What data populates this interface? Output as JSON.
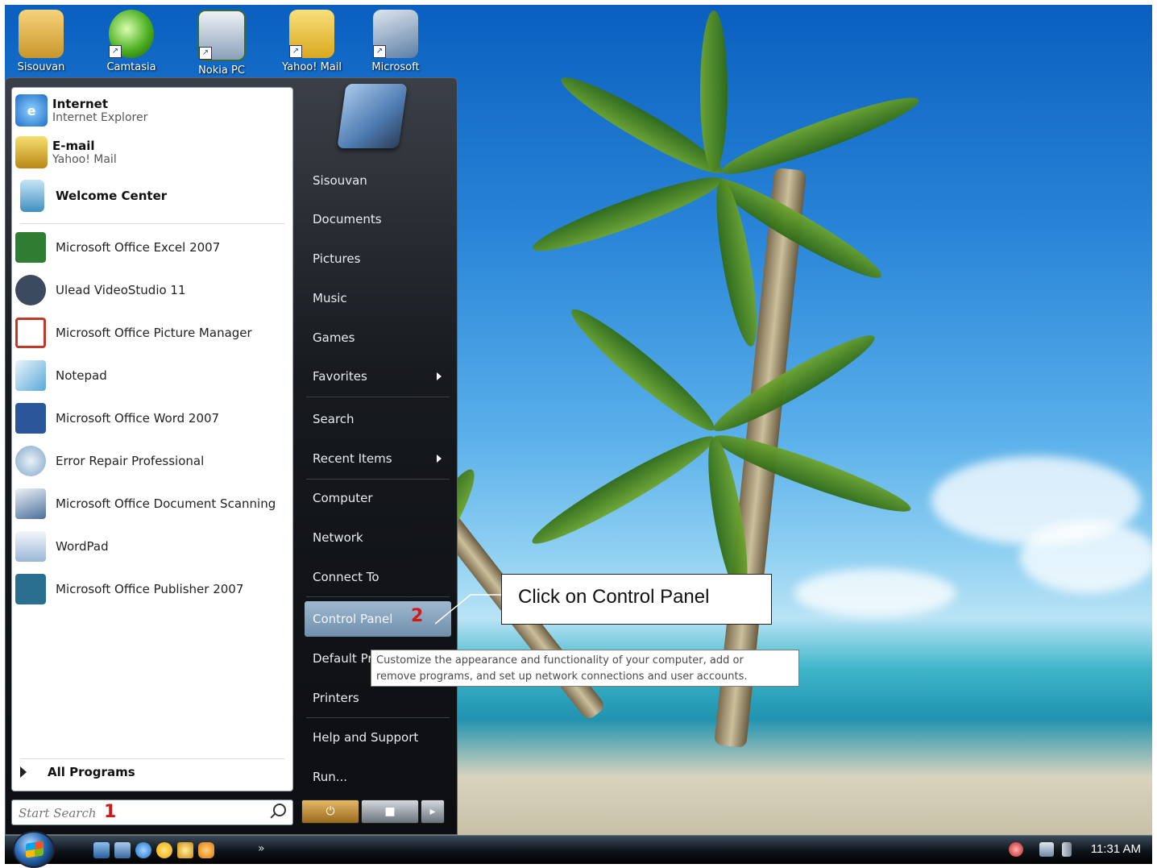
{
  "desktop": {
    "icons": [
      {
        "label": "Sisouvan",
        "icon": "folder-icon"
      },
      {
        "label": "Camtasia",
        "icon": "camtasia-icon"
      },
      {
        "label": "Nokia PC",
        "icon": "nokia-pc-suite-icon"
      },
      {
        "label": "Yahoo! Mail",
        "icon": "yahoo-mail-icon"
      },
      {
        "label": "Microsoft",
        "icon": "scanner-icon"
      }
    ]
  },
  "start_menu": {
    "pinned": [
      {
        "title": "Internet",
        "subtitle": "Internet Explorer",
        "icon": "internet-explorer-icon"
      },
      {
        "title": "E-mail",
        "subtitle": "Yahoo! Mail",
        "icon": "yahoo-mail-icon"
      }
    ],
    "welcome": {
      "title": "Welcome Center",
      "icon": "welcome-center-icon"
    },
    "programs": [
      {
        "label": "Microsoft Office Excel 2007",
        "icon": "excel-icon",
        "color": "#2f7d32"
      },
      {
        "label": "Ulead VideoStudio 11",
        "icon": "videostudio-icon",
        "color": "#3b4a5e"
      },
      {
        "label": "Microsoft Office Picture Manager",
        "icon": "picture-manager-icon",
        "color": "#c0392b"
      },
      {
        "label": "Notepad",
        "icon": "notepad-icon",
        "color": "#5aa9d8"
      },
      {
        "label": "Microsoft Office Word 2007",
        "icon": "word-icon",
        "color": "#2b579a"
      },
      {
        "label": "Error Repair Professional",
        "icon": "error-repair-icon",
        "color": "#7fa6c8"
      },
      {
        "label": "Microsoft Office Document Scanning",
        "icon": "document-scanning-icon",
        "color": "#4b6f9c"
      },
      {
        "label": "WordPad",
        "icon": "wordpad-icon",
        "color": "#9ab7d6"
      },
      {
        "label": "Microsoft Office Publisher 2007",
        "icon": "publisher-icon",
        "color": "#2a6f8f"
      }
    ],
    "all_programs": "All Programs",
    "search": {
      "placeholder": "Start Search",
      "step_marker": "1"
    },
    "right_items": [
      {
        "label": "Sisouvan",
        "submenu": false
      },
      {
        "label": "Documents",
        "submenu": false
      },
      {
        "label": "Pictures",
        "submenu": false
      },
      {
        "label": "Music",
        "submenu": false
      },
      {
        "label": "Games",
        "submenu": false
      },
      {
        "label": "Favorites",
        "submenu": true
      },
      {
        "label": "Search",
        "submenu": false
      },
      {
        "label": "Recent Items",
        "submenu": true
      },
      {
        "label": "Computer",
        "submenu": false
      },
      {
        "label": "Network",
        "submenu": false
      },
      {
        "label": "Connect To",
        "submenu": false
      },
      {
        "label": "Control Panel",
        "submenu": false,
        "highlighted": true,
        "step_marker": "2"
      },
      {
        "label": "Default Pr",
        "submenu": false
      },
      {
        "label": "Printers",
        "submenu": false
      },
      {
        "label": "Help and Support",
        "submenu": false
      },
      {
        "label": "Run...",
        "submenu": false
      }
    ]
  },
  "tooltip": {
    "line1": "Customize the appearance and functionality of your computer, add or",
    "line2": "remove programs, and set up network connections and user accounts."
  },
  "callout": {
    "text": "Click on Control Panel"
  },
  "taskbar": {
    "quick_launch": [
      "show-desktop-icon",
      "switch-windows-icon",
      "internet-explorer-icon",
      "messenger-icon",
      "camtasia-icon",
      "media-icon"
    ],
    "clock": "11:31 AM"
  }
}
